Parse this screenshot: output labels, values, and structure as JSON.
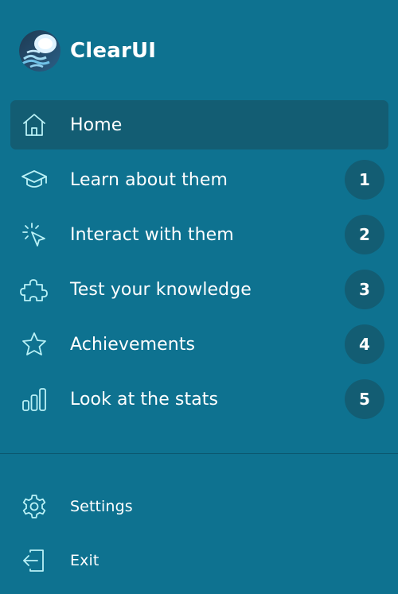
{
  "app": {
    "name": "ClearUI",
    "logo_icon": "jellyfish-logo"
  },
  "colors": {
    "background": "#0e7290",
    "active_item": "#135d73",
    "badge": "#135d73",
    "icon_stroke": "#b9f1f6",
    "text": "#ffffff"
  },
  "nav": {
    "items": [
      {
        "label": "Home",
        "icon": "home-icon",
        "active": true,
        "badge": ""
      },
      {
        "label": "Learn about them",
        "icon": "graduation-cap-icon",
        "active": false,
        "badge": "1"
      },
      {
        "label": "Interact with them",
        "icon": "cursor-click-icon",
        "active": false,
        "badge": "2"
      },
      {
        "label": "Test your knowledge",
        "icon": "puzzle-icon",
        "active": false,
        "badge": "3"
      },
      {
        "label": "Achievements",
        "icon": "star-icon",
        "active": false,
        "badge": "4"
      },
      {
        "label": "Look at the stats",
        "icon": "bar-chart-icon",
        "active": false,
        "badge": "5"
      }
    ]
  },
  "footer": {
    "items": [
      {
        "label": "Settings",
        "icon": "gear-icon"
      },
      {
        "label": "Exit",
        "icon": "exit-icon"
      }
    ]
  }
}
